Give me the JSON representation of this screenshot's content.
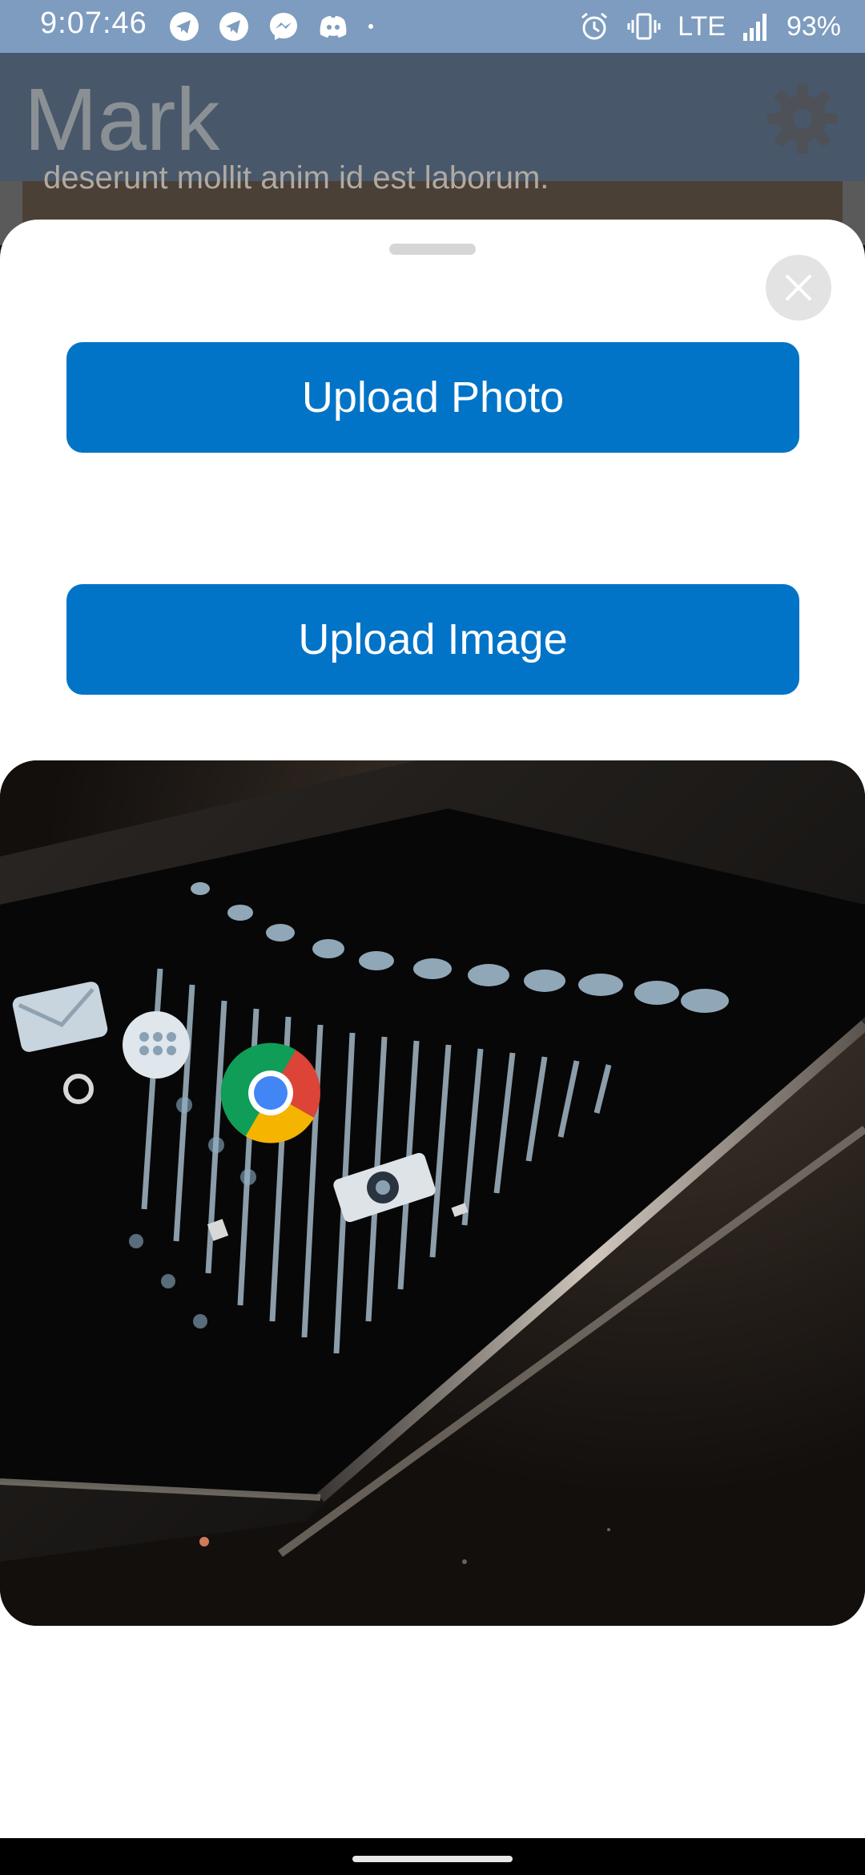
{
  "status_bar": {
    "time": "9:07:46",
    "network": "LTE",
    "battery": "93%",
    "left_icons": [
      "telegram-icon",
      "telegram-icon",
      "messenger-icon",
      "discord-icon",
      "dot-icon"
    ],
    "right_icons": [
      "alarm-icon",
      "vibrate-icon",
      "signal-icon"
    ]
  },
  "background_app": {
    "title": "Mark",
    "content_text": "deserunt mollit anim id est laborum.",
    "settings_icon": "gear-icon"
  },
  "sheet": {
    "close_icon": "close-icon",
    "buttons": {
      "upload_photo": "Upload Photo",
      "upload_image": "Upload Image"
    },
    "preview": {
      "subject": "photo-preview"
    }
  },
  "colors": {
    "status_bar": "#7d9cbf",
    "header_dimmed": "#48586a",
    "button_primary": "#0274c8",
    "sheet_bg": "#ffffff"
  }
}
